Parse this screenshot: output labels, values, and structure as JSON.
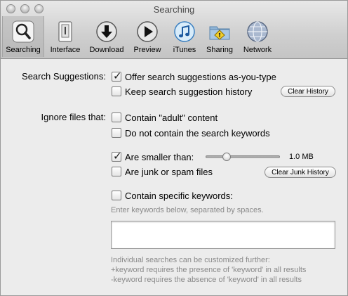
{
  "window": {
    "title": "Searching"
  },
  "toolbar": {
    "items": [
      {
        "label": "Searching",
        "icon": "magnifier-icon",
        "selected": true
      },
      {
        "label": "Interface",
        "icon": "interface-icon",
        "selected": false
      },
      {
        "label": "Download",
        "icon": "download-icon",
        "selected": false
      },
      {
        "label": "Preview",
        "icon": "play-icon",
        "selected": false
      },
      {
        "label": "iTunes",
        "icon": "itunes-icon",
        "selected": false
      },
      {
        "label": "Sharing",
        "icon": "sharing-folder-icon",
        "selected": false
      },
      {
        "label": "Network",
        "icon": "network-globe-icon",
        "selected": false
      }
    ]
  },
  "suggestions": {
    "label": "Search Suggestions:",
    "offer": {
      "label": "Offer search suggestions as-you-type",
      "checked": true
    },
    "keep": {
      "label": "Keep search suggestion history",
      "checked": false
    },
    "clear_button": "Clear History"
  },
  "ignore": {
    "label": "Ignore files that:",
    "adult": {
      "label": "Contain \"adult\" content",
      "checked": false
    },
    "no_keywords": {
      "label": "Do not contain the search keywords",
      "checked": false
    },
    "smaller": {
      "label": "Are smaller than:",
      "checked": true,
      "value_text": "1.0 MB",
      "slider_fraction": 0.28
    },
    "junk": {
      "label": "Are junk or spam files",
      "checked": false
    },
    "clear_junk_button": "Clear Junk History",
    "specific": {
      "label": "Contain specific keywords:",
      "checked": false
    },
    "keywords_hint": "Enter keywords below, separated by spaces.",
    "keywords_value": "",
    "notes": [
      "Individual searches can be customized further:",
      "+keyword requires the presence of 'keyword' in all results",
      "-keyword requires the absence of 'keyword' in all results"
    ]
  }
}
